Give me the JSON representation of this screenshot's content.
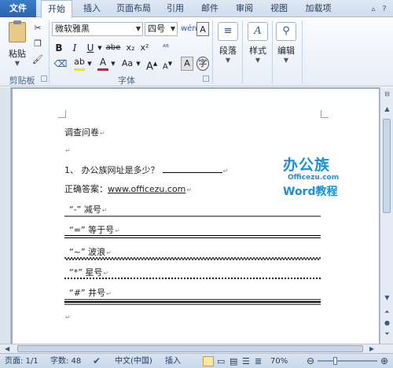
{
  "tabs": [
    "文件",
    "开始",
    "插入",
    "页面布局",
    "引用",
    "邮件",
    "审阅",
    "视图",
    "加载项"
  ],
  "ribbon": {
    "clipboard": {
      "paste_label": "粘贴",
      "group_label": "剪贴板"
    },
    "font": {
      "font_name": "微软雅黑",
      "font_size": "四号",
      "group_label": "字体",
      "buttons": [
        "B",
        "I",
        "U",
        "abe",
        "x₂",
        "x²",
        "A",
        "Aa"
      ]
    },
    "paragraph": {
      "label": "段落"
    },
    "styles": {
      "label": "样式"
    },
    "editing": {
      "label": "编辑"
    }
  },
  "document": {
    "title": "调查问卷",
    "question": "1、   办公族网址是多少？",
    "answer_label": "正确答案：",
    "answer_link": "www.officezu.com",
    "items": [
      "“-” 减号",
      "“=” 等于号",
      "“~” 波浪",
      "“*” 星号",
      "“#” 井号"
    ],
    "logo": {
      "line1": "办公族",
      "line2": "Officezu.com",
      "line3": "Word教程"
    }
  },
  "status": {
    "page": "页面: 1/1",
    "words": "字数: 48",
    "language": "中文(中国)",
    "mode": "插入",
    "zoom": "70%"
  },
  "colors": {
    "accent": "#2a62ad",
    "logo": "#1b8fd8"
  }
}
